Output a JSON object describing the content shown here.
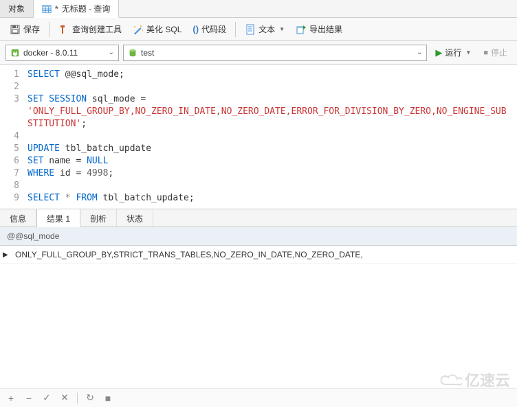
{
  "tabs": {
    "object": "对象",
    "query_title": "无标题 - 查询",
    "modified_marker": "*"
  },
  "toolbar": {
    "save": "保存",
    "query_builder": "查询创建工具",
    "beautify": "美化 SQL",
    "snippets": "代码段",
    "text": "文本",
    "export": "导出结果"
  },
  "conn": {
    "connection": "docker - 8.0.11",
    "database": "test",
    "run": "运行",
    "stop": "停止"
  },
  "code": {
    "l1_kw": "SELECT",
    "l1_rest": " @@sql_mode;",
    "l3a": "SET SESSION",
    "l3b": " sql_mode = ",
    "l4_str": "'ONLY_FULL_GROUP_BY,NO_ZERO_IN_DATE,NO_ZERO_DATE,ERROR_FOR_DIVISION_BY_ZERO,NO_ENGINE_SUBSTITUTION'",
    "l4_end": ";",
    "l5a": "UPDATE",
    "l5b": " tbl_batch_update",
    "l6a": "SET",
    "l6b": " name = ",
    "l6c": "NULL",
    "l7a": "WHERE",
    "l7b": " id = ",
    "l7c": "4998",
    "l7d": ";",
    "l9a": "SELECT",
    "l9b": " * ",
    "l9c": "FROM",
    "l9d": " tbl_batch_update;"
  },
  "result_tabs": {
    "info": "信息",
    "result1": "结果 1",
    "profile": "剖析",
    "status": "状态"
  },
  "grid": {
    "header": "@@sql_mode",
    "row1": "ONLY_FULL_GROUP_BY,STRICT_TRANS_TABLES,NO_ZERO_IN_DATE,NO_ZERO_DATE,"
  },
  "watermark": "亿速云"
}
